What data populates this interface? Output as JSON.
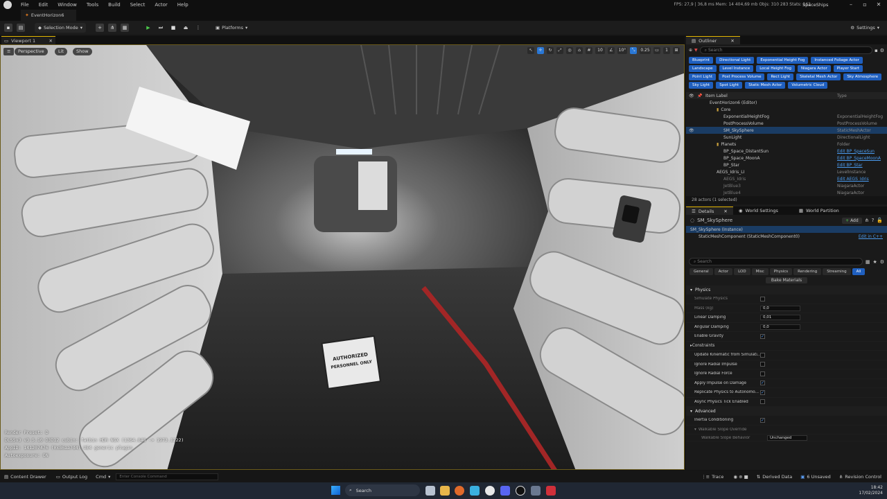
{
  "menubar": {
    "items": [
      "File",
      "Edit",
      "Window",
      "Tools",
      "Build",
      "Select",
      "Actor",
      "Help"
    ],
    "stats": "FPS: 27,9  |  36,8 ms  Mem: 14 404,69 mb  Objs: 310 283  Stats: 162",
    "project": "SpaceShips"
  },
  "tab": {
    "label": "EventHorizon6"
  },
  "toolbar": {
    "selection_mode": "Selection Mode",
    "platforms": "Platforms",
    "settings": "Settings"
  },
  "viewport": {
    "tab_label": "Viewport 1",
    "perspective": "Perspective",
    "lit": "Lit",
    "show": "Show",
    "grid_snap": "10",
    "rot_snap": "10°",
    "scale_snap": "0.25",
    "cam_speed": "1",
    "sign_line1": "AUTHORIZED",
    "sign_line2": "PERSONNEL ONLY",
    "debug": [
      "Render Preset: D",
      "DLSSv3 v3.5.10 D3D12 cubin: fatbin HDR NGX (1364.848 -> 1973.1222)",
      "AppID: 141207476 (0x86aa7d4)  UE4 generic plugin",
      "Autoexposure: ON"
    ]
  },
  "outliner": {
    "title": "Outliner",
    "search_placeholder": "Search",
    "chips": [
      "Blueprint",
      "Directional Light",
      "Exponential Height Fog",
      "Instanced Foliage Actor",
      "Landscape",
      "Level Instance",
      "Local Height Fog",
      "Niagara Actor",
      "Player Start",
      "Point Light",
      "Post Process Volume",
      "Rect Light",
      "Skeletal Mesh Actor",
      "Sky Atmosphere",
      "Sky Light",
      "Spot Light",
      "Static Mesh Actor",
      "Volumetric Cloud"
    ],
    "col_label": "Item Label",
    "col_type": "Type",
    "rows": [
      {
        "label": "EventHorizon6 (Editor)",
        "type": "",
        "indent": 0,
        "folder": false
      },
      {
        "label": "Core",
        "type": "",
        "indent": 1,
        "folder": true
      },
      {
        "label": "ExponentialHeightFog",
        "type": "ExponentialHeightFog",
        "indent": 2,
        "folder": false
      },
      {
        "label": "PostProcessVolume",
        "type": "PostProcessVolume",
        "indent": 2,
        "folder": false
      },
      {
        "label": "SM_SkySphere",
        "type": "StaticMeshActor",
        "indent": 2,
        "folder": false,
        "selected": true
      },
      {
        "label": "SunLight",
        "type": "DirectionalLight",
        "indent": 2,
        "folder": false
      },
      {
        "label": "Planets",
        "type": "Folder",
        "indent": 1,
        "folder": true
      },
      {
        "label": "BP_Space_DistantSun",
        "type": "Edit BP_SpaceSun",
        "indent": 2,
        "folder": false,
        "link": true
      },
      {
        "label": "BP_Space_MoonA",
        "type": "Edit BP_SpaceMoonA",
        "indent": 2,
        "folder": false,
        "link": true
      },
      {
        "label": "BP_Star",
        "type": "Edit BP_Star",
        "indent": 2,
        "folder": false,
        "link": true
      },
      {
        "label": "AEGS_Idris_LI",
        "type": "LevelInstance",
        "indent": 1,
        "folder": false
      },
      {
        "label": "AEGS_Idris",
        "type": "Edit AEGS_Idris",
        "indent": 2,
        "folder": false,
        "link": true,
        "dim": true
      },
      {
        "label": "JetBlue3",
        "type": "NiagaraActor",
        "indent": 2,
        "folder": false,
        "dim": true
      },
      {
        "label": "JetBlue4",
        "type": "NiagaraActor",
        "indent": 2,
        "folder": false,
        "dim": true
      },
      {
        "label": "JetBlue5",
        "type": "NiagaraActor",
        "indent": 2,
        "folder": false,
        "dim": true
      }
    ],
    "count": "28 actors (1 selected)"
  },
  "details": {
    "tabs": [
      "Details",
      "World Settings",
      "World Partition"
    ],
    "object": "SM_SkySphere",
    "add": "Add",
    "instance": "SM_SkySphere (Instance)",
    "component": "StaticMeshComponent (StaticMeshComponent0)",
    "edit_cpp": "Edit in C++",
    "search_placeholder": "Search",
    "filters": [
      "General",
      "Actor",
      "LOD",
      "Misc",
      "Physics",
      "Rendering",
      "Streaming",
      "All"
    ],
    "bake": "Bake Materials",
    "physics_header": "Physics",
    "props": [
      {
        "name": "Simulate Physics",
        "kind": "check",
        "value": "",
        "dim": true
      },
      {
        "name": "Mass (kg)",
        "kind": "num",
        "value": "0,0",
        "dim": true
      },
      {
        "name": "Linear Damping",
        "kind": "num",
        "value": "0,01"
      },
      {
        "name": "Angular Damping",
        "kind": "num",
        "value": "0,0"
      },
      {
        "name": "Enable Gravity",
        "kind": "check",
        "value": "✓"
      },
      {
        "name": "Constraints",
        "kind": "section",
        "value": ""
      },
      {
        "name": "Update Kinematic from Simulati...",
        "kind": "check",
        "value": ""
      },
      {
        "name": "Ignore Radial Impulse",
        "kind": "check",
        "value": ""
      },
      {
        "name": "Ignore Radial Force",
        "kind": "check",
        "value": ""
      },
      {
        "name": "Apply Impulse on Damage",
        "kind": "check",
        "value": "✓"
      },
      {
        "name": "Replicate Physics to Autonomo...",
        "kind": "check",
        "value": "✓"
      },
      {
        "name": "Async Physics Tick Enabled",
        "kind": "check",
        "value": ""
      }
    ],
    "advanced_header": "Advanced",
    "inertia": "Inertia Conditioning",
    "inertia_value": "✓",
    "walkable": "Walkable Slope Override",
    "walkable_behavior": "Walkable Slope Behavior",
    "walkable_value": "Unchanged"
  },
  "statusbar": {
    "content_drawer": "Content Drawer",
    "output_log": "Output Log",
    "cmd": "Cmd",
    "console_placeholder": "Enter Console Command",
    "trace": "Trace",
    "derived": "Derived Data",
    "unsaved": "6 Unsaved",
    "revision": "Revision Control"
  },
  "taskbar": {
    "search": "Search",
    "time": "18:42",
    "date": "17/02/2024"
  }
}
